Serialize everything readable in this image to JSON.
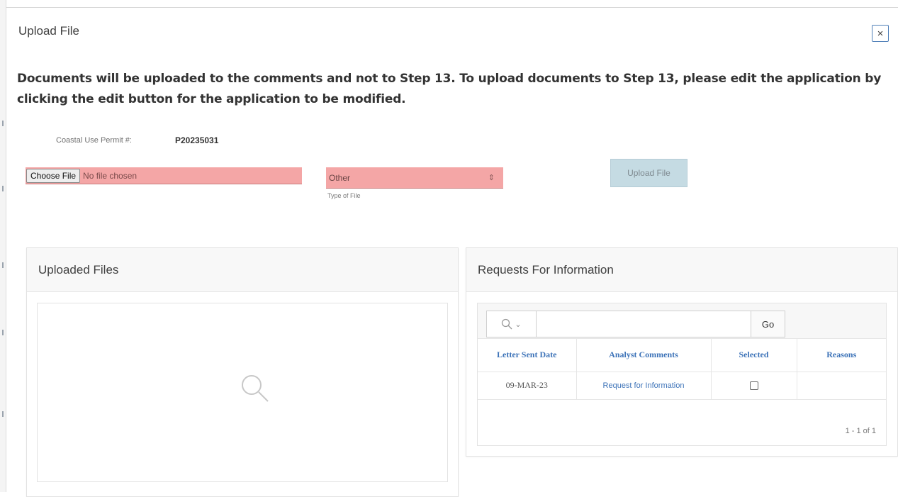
{
  "dialog": {
    "title": "Upload File",
    "close_label": "×"
  },
  "notice": "Documents will be uploaded to the comments and not to Step 13. To upload documents to Step 13, please edit the application by clicking the edit button for the application to be modified.",
  "permit": {
    "label": "Coastal Use Permit #:",
    "value": "P20235031"
  },
  "file_input": {
    "button_label": "Choose File",
    "status": "No file chosen"
  },
  "file_type": {
    "selected": "Other",
    "caption": "Type of File"
  },
  "upload_button": "Upload File",
  "uploaded_files": {
    "title": "Uploaded Files"
  },
  "requests": {
    "title": "Requests For Information",
    "go_label": "Go",
    "search_value": "",
    "columns": [
      "Letter Sent Date",
      "Analyst Comments",
      "Selected",
      "Reasons"
    ],
    "rows": [
      {
        "letter_sent_date": "09-MAR-23",
        "analyst_comments": "Request for Information",
        "selected": false,
        "reasons": ""
      }
    ],
    "pagination": "1 - 1 of 1"
  },
  "colors": {
    "required_field": "#f4a6a6",
    "link": "#3d73b8",
    "upload_button_bg": "#c5dbe3"
  }
}
